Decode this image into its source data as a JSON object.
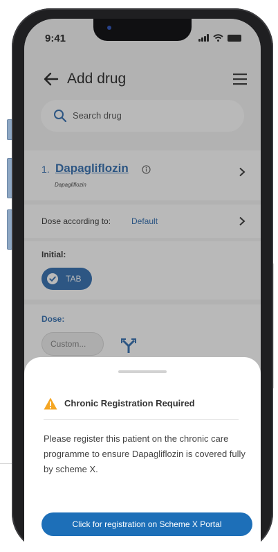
{
  "status": {
    "time": "9:41"
  },
  "header": {
    "title": "Add drug"
  },
  "search": {
    "placeholder": "Search drug"
  },
  "drug": {
    "number": "1.",
    "name": "Dapagliflozin",
    "subtitle": "Dapagliflozin"
  },
  "dose_row": {
    "label": "Dose according to:",
    "value": "Default"
  },
  "initial": {
    "label": "Initial:",
    "chip": "TAB"
  },
  "dose": {
    "label": "Dose:",
    "placeholder": "Custom..."
  },
  "sheet": {
    "title": "Chronic Registration Required",
    "body": "Please register this patient on the chronic care programme to ensure Dapagliflozin is covered fully by scheme X.",
    "button": "Click for registration on Scheme X Portal"
  },
  "colors": {
    "accent": "#1d5fa8",
    "warning": "#f5a623",
    "button": "#1d6fb8"
  },
  "icons": [
    "back-arrow-icon",
    "menu-icon",
    "search-icon",
    "info-icon",
    "chevron-right-icon",
    "check-circle-icon",
    "fork-arrows-icon",
    "warning-icon"
  ]
}
